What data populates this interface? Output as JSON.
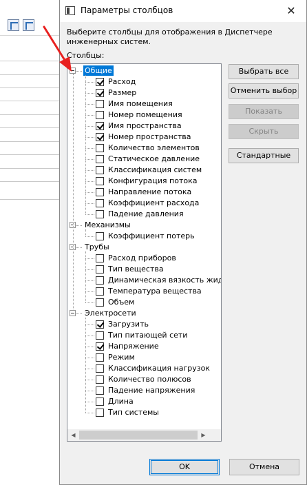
{
  "dialog": {
    "title": "Параметры столбцов",
    "close_glyph": "✕",
    "description": "Выберите столбцы для отображения в Диспетчере инженерных систем.",
    "columns_label": "Столбцы:"
  },
  "groups": [
    {
      "label": "Общие",
      "selected": true,
      "items": [
        {
          "label": "Расход",
          "checked": true
        },
        {
          "label": "Размер",
          "checked": true
        },
        {
          "label": "Имя помещения",
          "checked": false
        },
        {
          "label": "Номер помещения",
          "checked": false
        },
        {
          "label": "Имя пространства",
          "checked": true
        },
        {
          "label": "Номер пространства",
          "checked": true
        },
        {
          "label": "Количество элементов",
          "checked": false
        },
        {
          "label": "Статическое давление",
          "checked": false
        },
        {
          "label": "Классификация систем",
          "checked": false
        },
        {
          "label": "Конфигурация потока",
          "checked": false
        },
        {
          "label": "Направление потока",
          "checked": false
        },
        {
          "label": "Коэффициент расхода",
          "checked": false
        },
        {
          "label": "Падение давления",
          "checked": false
        }
      ]
    },
    {
      "label": "Механизмы",
      "selected": false,
      "items": [
        {
          "label": "Коэффициент потерь",
          "checked": false
        }
      ]
    },
    {
      "label": "Трубы",
      "selected": false,
      "items": [
        {
          "label": "Расход приборов",
          "checked": false
        },
        {
          "label": "Тип вещества",
          "checked": false
        },
        {
          "label": "Динамическая вязкость жидко",
          "checked": false
        },
        {
          "label": "Температура вещества",
          "checked": false
        },
        {
          "label": "Объем",
          "checked": false
        }
      ]
    },
    {
      "label": "Электросети",
      "selected": false,
      "items": [
        {
          "label": "Загрузить",
          "checked": true
        },
        {
          "label": "Тип питающей сети",
          "checked": false
        },
        {
          "label": "Напряжение",
          "checked": true
        },
        {
          "label": "Режим",
          "checked": false
        },
        {
          "label": "Классификация нагрузок",
          "checked": false
        },
        {
          "label": "Количество полюсов",
          "checked": false
        },
        {
          "label": "Падение напряжения",
          "checked": false
        },
        {
          "label": "Длина",
          "checked": false
        },
        {
          "label": "Тип системы",
          "checked": false
        }
      ]
    }
  ],
  "buttons": {
    "select_all": "Выбрать все",
    "deselect": "Отменить выбор",
    "show": "Показать",
    "hide": "Скрыть",
    "standard": "Стандартные",
    "ok": "OK",
    "cancel": "Отмена"
  },
  "colors": {
    "selection": "#0078d7",
    "annotation_arrow": "#e8201f"
  }
}
